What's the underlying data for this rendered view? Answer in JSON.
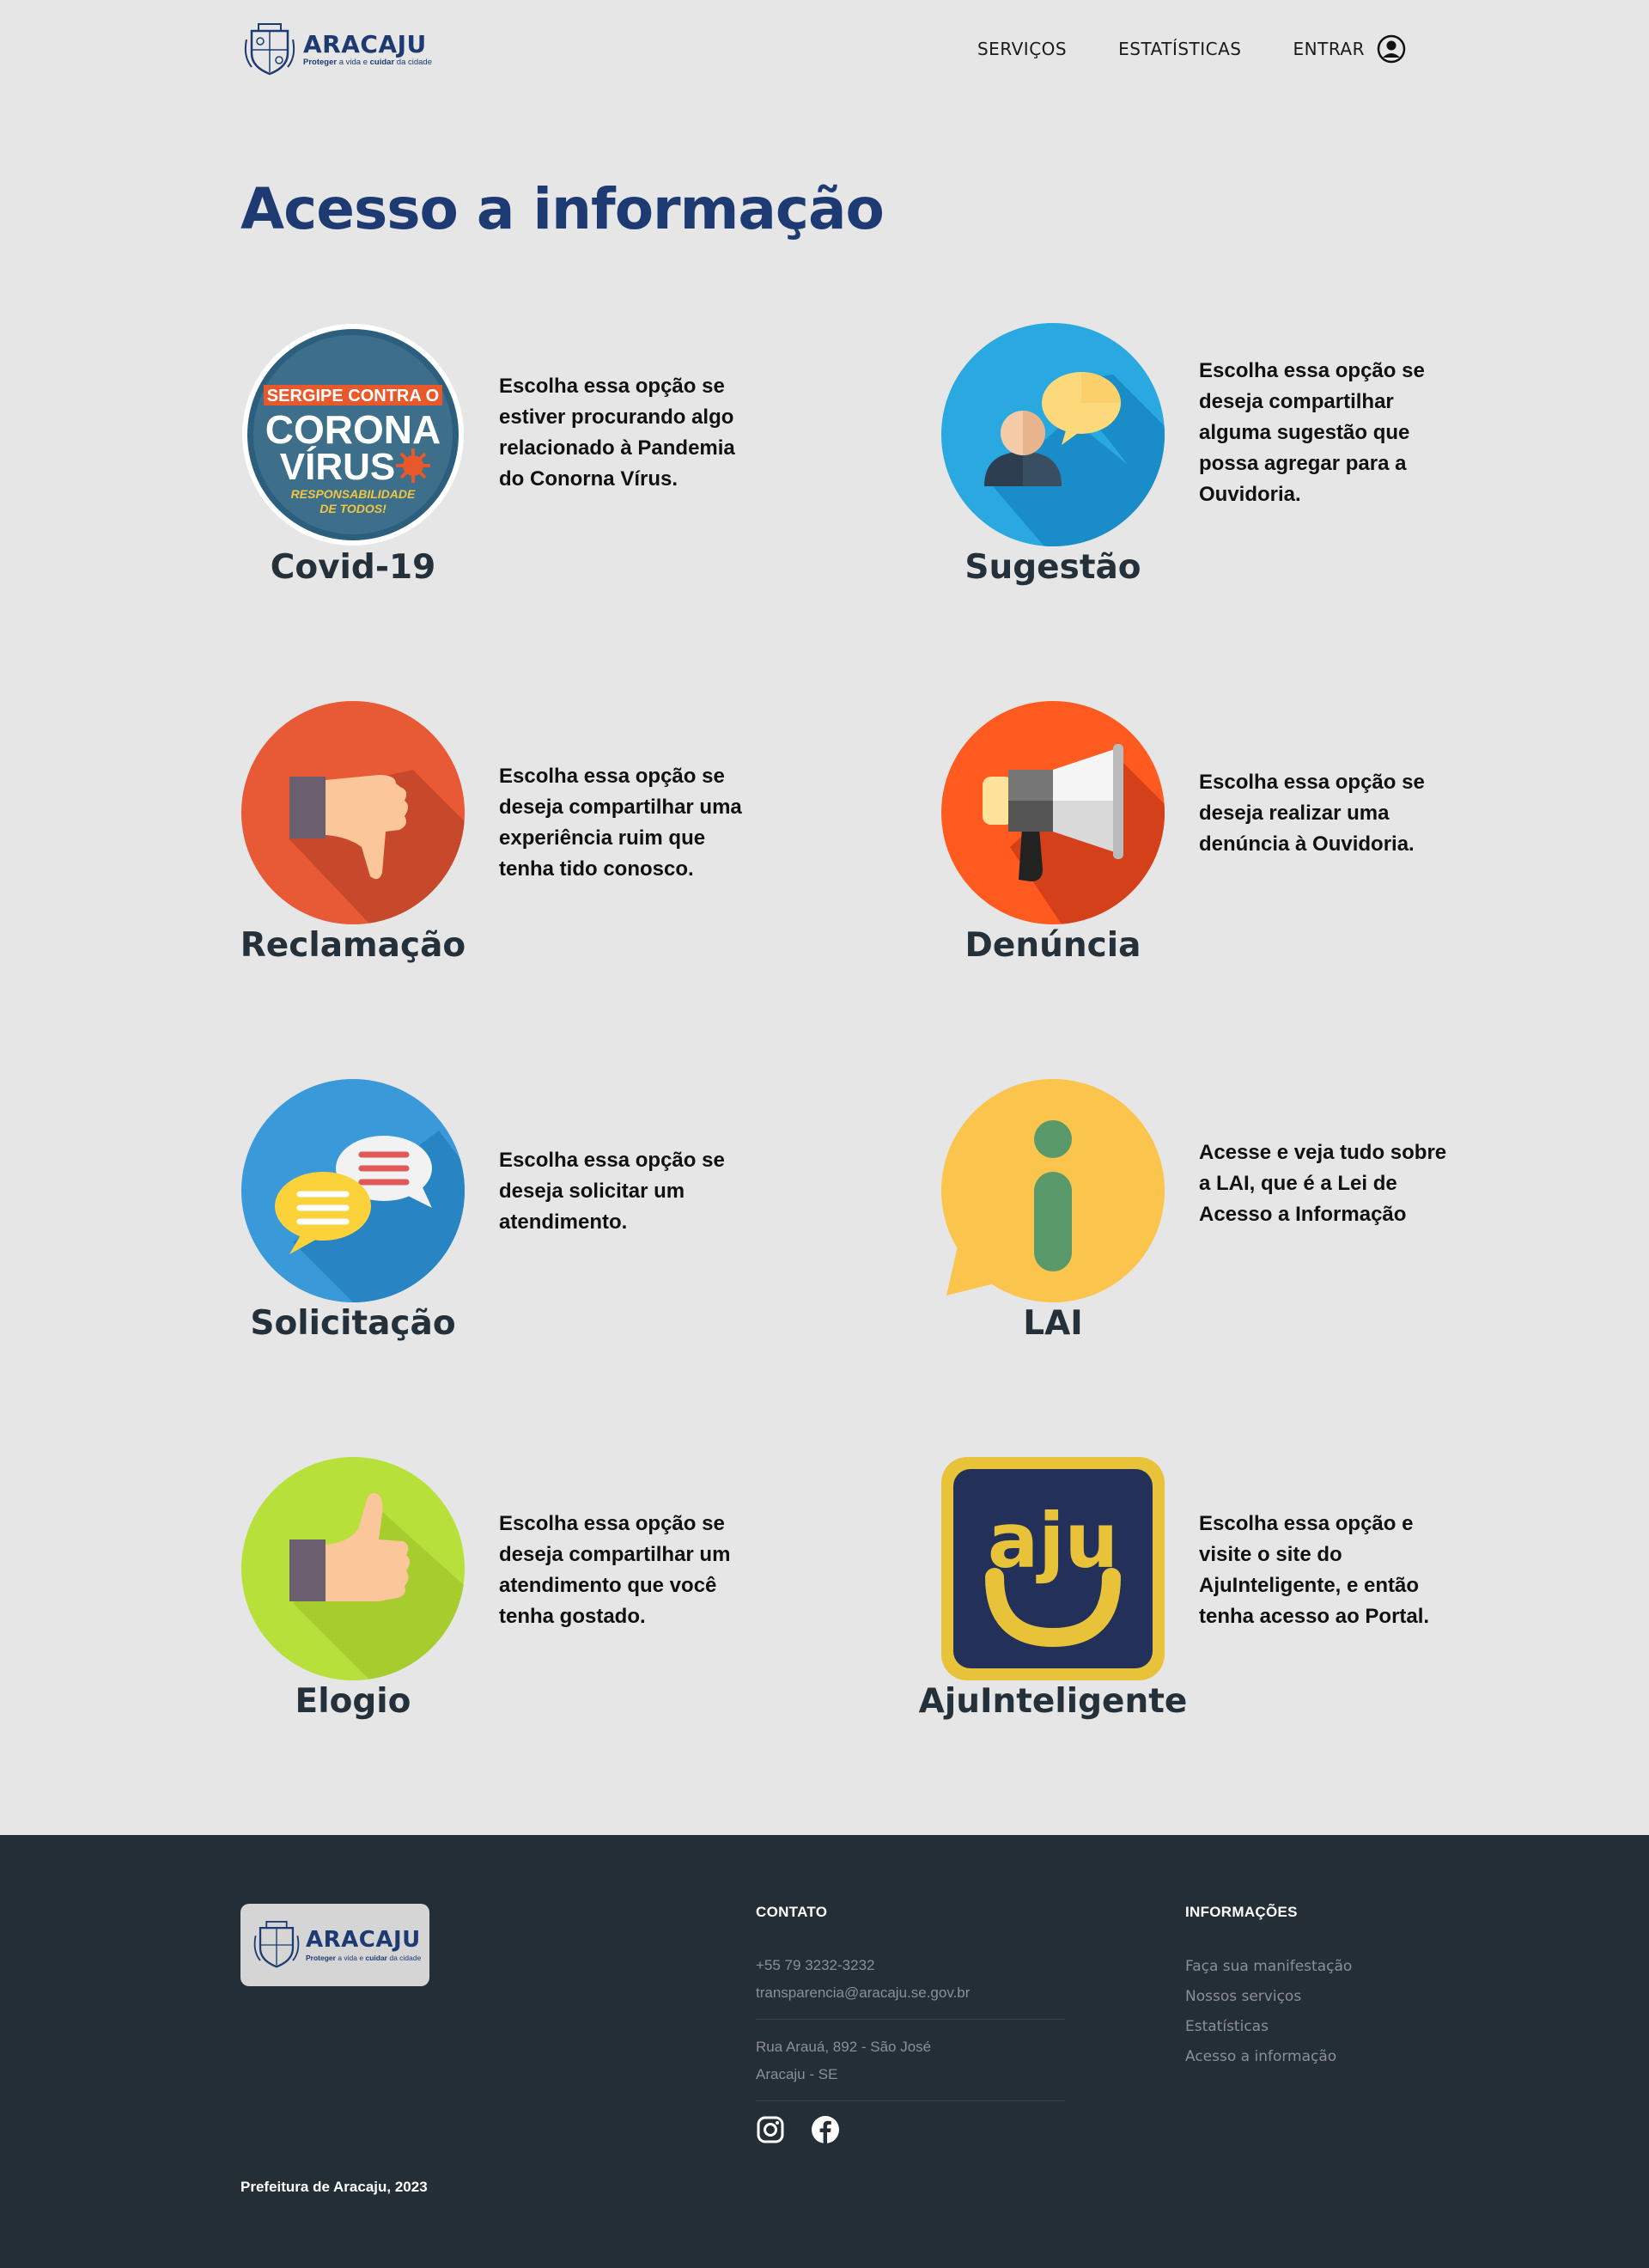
{
  "header": {
    "logo": {
      "name": "ARACAJU",
      "tagline_1": "Proteger",
      "tagline_2": " a vida e ",
      "tagline_3": "cuidar",
      "tagline_4": " da cidade"
    },
    "nav": {
      "services": "SERVIÇOS",
      "statistics": "ESTATÍSTICAS",
      "login": "ENTRAR"
    }
  },
  "main": {
    "title": "Acesso a informação",
    "cards": [
      {
        "label": "Covid-19",
        "description": "Escolha essa opção se estiver procurando algo relacionado à Pandemia do Conorna Vírus.",
        "icon": "coronavirus-badge-icon",
        "badge": {
          "line1": "SERGIPE CONTRA O",
          "line2": "CORONA",
          "line3": "VÍRUS",
          "line4": "RESPONSABILIDADE",
          "line5": "DE TODOS!"
        }
      },
      {
        "label": "Sugestão",
        "description": "Escolha essa opção se deseja compartilhar alguma sugestão que possa agregar para a Ouvidoria.",
        "icon": "person-thought-bubble-icon"
      },
      {
        "label": "Reclamação",
        "description": "Escolha essa opção se deseja compartilhar uma experiência ruim que tenha tido conosco.",
        "icon": "thumbs-down-icon"
      },
      {
        "label": "Denúncia",
        "description": "Escolha essa opção se deseja realizar uma denúncia à Ouvidoria.",
        "icon": "megaphone-icon"
      },
      {
        "label": "Solicitação",
        "description": "Escolha essa opção se deseja solicitar um atendimento.",
        "icon": "chat-bubbles-icon"
      },
      {
        "label": "LAI",
        "description": "Acesse e veja tudo sobre a LAI, que é a Lei de Acesso a Informação",
        "icon": "info-icon"
      },
      {
        "label": "Elogio",
        "description": "Escolha essa opção se deseja compartilhar um atendimento que você tenha gostado.",
        "icon": "thumbs-up-icon"
      },
      {
        "label": "AjuInteligente",
        "description": "Escolha essa opção e visite o site do AjuInteligente, e então tenha acesso ao Portal.",
        "icon": "aju-app-icon",
        "app_text": "aju"
      }
    ]
  },
  "footer": {
    "logo": {
      "name": "ARACAJU",
      "tagline_1": "Proteger",
      "tagline_2": " a vida e ",
      "tagline_3": "cuidar",
      "tagline_4": " da cidade"
    },
    "contact": {
      "heading": "CONTATO",
      "phone": "+55 79 3232-3232",
      "email": "transparencia@aracaju.se.gov.br",
      "address_1": "Rua Arauá, 892 - São José",
      "address_2": "Aracaju - SE"
    },
    "info": {
      "heading": "INFORMAÇÕES",
      "links": [
        "Faça sua manifestação",
        "Nossos serviços",
        "Estatísticas",
        "Acesso a informação"
      ]
    },
    "social": [
      "instagram-icon",
      "facebook-icon"
    ],
    "copyright": "Prefeitura de Aracaju, 2023"
  },
  "colors": {
    "background": "#e6e6e6",
    "title": "#1e3a72",
    "card_label": "#24313a",
    "footer_bg": "#242e36"
  }
}
